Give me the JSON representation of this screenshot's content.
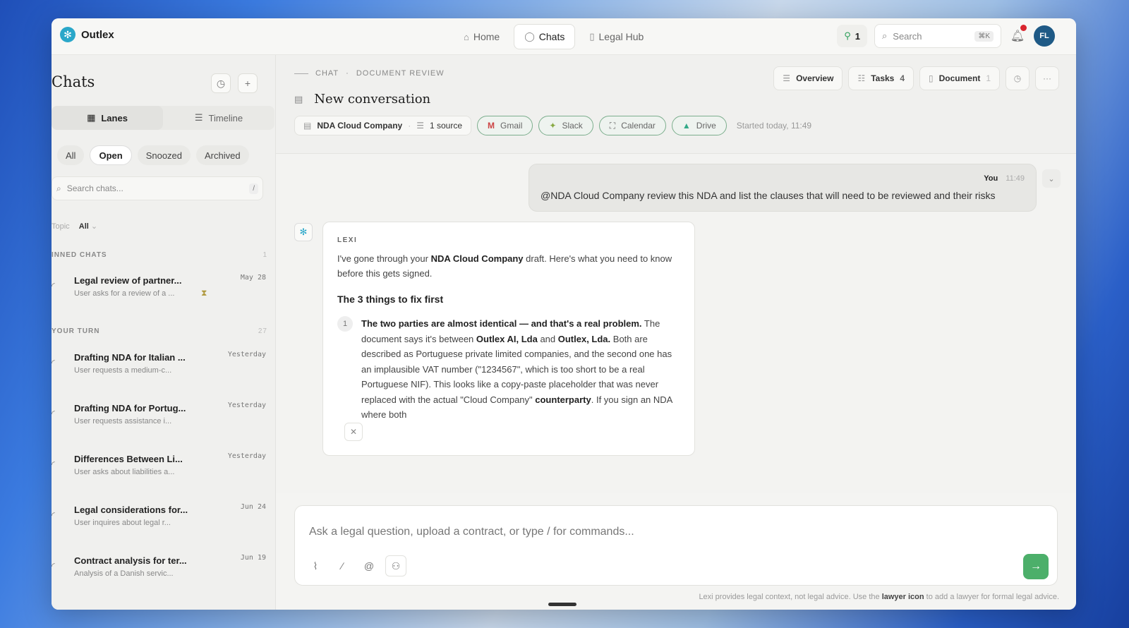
{
  "app": {
    "name": "Outlex"
  },
  "nav": {
    "home": "Home",
    "chats": "Chats",
    "legal_hub": "Legal Hub"
  },
  "topbar": {
    "count": "1",
    "search_placeholder": "Search",
    "search_kbd": "⌘K",
    "avatar": "FL"
  },
  "sidebar": {
    "title": "Chats",
    "segments": {
      "lanes": "Lanes",
      "timeline": "Timeline"
    },
    "filters": {
      "all": "All",
      "open": "Open",
      "snoozed": "Snoozed",
      "archived": "Archived"
    },
    "search_placeholder": "Search chats...",
    "search_kbd": "/",
    "topic_label": "Topic",
    "topic_value": "All",
    "pinned": {
      "label": "INNED CHATS",
      "count": "1",
      "items": [
        {
          "title": "Legal review of partner...",
          "sub": "User asks for a review of a ...",
          "date": "May 28"
        }
      ]
    },
    "your_turn": {
      "label": "YOUR TURN",
      "count": "27",
      "items": [
        {
          "title": "Drafting NDA for Italian ...",
          "sub": "User requests a medium-c...",
          "date": "Yesterday"
        },
        {
          "title": "Drafting NDA for Portug...",
          "sub": "User requests assistance i...",
          "date": "Yesterday"
        },
        {
          "title": "Differences Between Li...",
          "sub": "User asks about liabilities a...",
          "date": "Yesterday"
        },
        {
          "title": "Legal considerations for...",
          "sub": "User inquires about legal r...",
          "date": "Jun 24"
        },
        {
          "title": "Contract analysis for ter...",
          "sub": "Analysis of a Danish servic...",
          "date": "Jun 19"
        }
      ]
    }
  },
  "main": {
    "crumb": {
      "a": "CHAT",
      "b": "DOCUMENT REVIEW"
    },
    "title": "New conversation",
    "source_chip": {
      "name": "NDA Cloud Company",
      "sources": "1 source"
    },
    "connectors": {
      "gmail": "Gmail",
      "slack": "Slack",
      "calendar": "Calendar",
      "drive": "Drive"
    },
    "started": "Started today, 11:49",
    "actions": {
      "overview": "Overview",
      "tasks": "Tasks",
      "tasks_count": "4",
      "document": "Document",
      "document_count": "1"
    }
  },
  "thread": {
    "user": {
      "author": "You",
      "time": "11:49",
      "text": "@NDA Cloud Company review this NDA and list the clauses that will need to be reviewed and their risks"
    },
    "bot": {
      "name": "LEXI",
      "intro_1": "I've gone through your ",
      "intro_bold": "NDA Cloud Company",
      "intro_2": " draft. Here's what you need to know before this gets signed.",
      "heading": "The 3 things to fix first",
      "point_num": "1",
      "p_bold1": "The two parties are almost identical — and that's a real problem.",
      "p_1": " The document says it's between ",
      "p_bold2": "Outlex AI, Lda",
      "p_2": " and ",
      "p_bold3": "Outlex, Lda.",
      "p_3": " Both are described as Portuguese private limited companies, and the second one has an implausible VAT number (\"1234567\", which is too short to be a real Portuguese NIF). This looks like a copy-paste placeholder that was never replaced with the actual \"Cloud Company\" ",
      "p_bold4": "counterparty",
      "p_4": ". If you sign an NDA where both"
    }
  },
  "composer": {
    "placeholder": "Ask a legal question, upload a contract, or type / for commands..."
  },
  "footer": {
    "pre": "Lexi provides legal context, not legal advice. Use the ",
    "bold": "lawyer icon",
    "post": " to add a lawyer for formal legal advice."
  }
}
